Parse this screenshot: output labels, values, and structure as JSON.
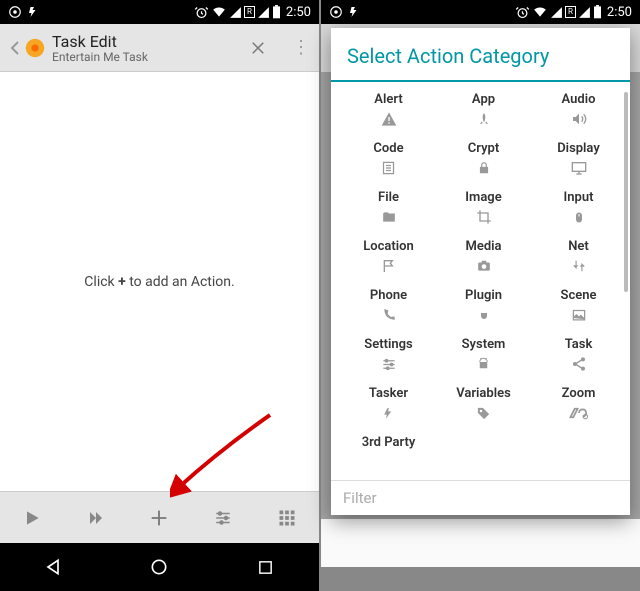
{
  "statusbar": {
    "time": "2:50",
    "r_badge": "R"
  },
  "left": {
    "header": {
      "title": "Task Edit",
      "subtitle": "Entertain Me Task"
    },
    "empty_prefix": "Click ",
    "empty_plus": "+",
    "empty_suffix": " to add an Action."
  },
  "right": {
    "dialog_title": "Select Action Category",
    "filter_placeholder": "Filter",
    "categories": [
      {
        "label": "Alert",
        "icon": "warning"
      },
      {
        "label": "App",
        "icon": "rocket"
      },
      {
        "label": "Audio",
        "icon": "volume"
      },
      {
        "label": "Code",
        "icon": "list"
      },
      {
        "label": "Crypt",
        "icon": "lock"
      },
      {
        "label": "Display",
        "icon": "monitor"
      },
      {
        "label": "File",
        "icon": "folder"
      },
      {
        "label": "Image",
        "icon": "crop"
      },
      {
        "label": "Input",
        "icon": "mouse"
      },
      {
        "label": "Location",
        "icon": "flag"
      },
      {
        "label": "Media",
        "icon": "camera"
      },
      {
        "label": "Net",
        "icon": "updown"
      },
      {
        "label": "Phone",
        "icon": "phone"
      },
      {
        "label": "Plugin",
        "icon": "plug"
      },
      {
        "label": "Scene",
        "icon": "picture"
      },
      {
        "label": "Settings",
        "icon": "sliders"
      },
      {
        "label": "System",
        "icon": "android"
      },
      {
        "label": "Task",
        "icon": "share"
      },
      {
        "label": "Tasker",
        "icon": "bolt"
      },
      {
        "label": "Variables",
        "icon": "tag"
      },
      {
        "label": "Zoom",
        "icon": "zoom"
      },
      {
        "label": "3rd Party",
        "icon": ""
      }
    ]
  }
}
